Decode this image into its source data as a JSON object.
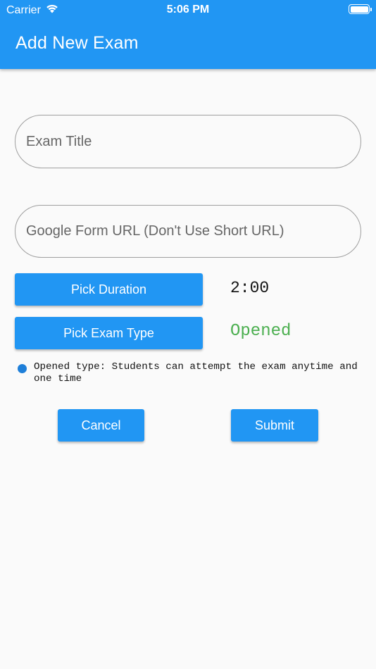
{
  "status_bar": {
    "carrier": "Carrier",
    "time": "5:06 PM",
    "icons": [
      "wifi-icon",
      "battery-icon"
    ]
  },
  "app_bar": {
    "title": "Add New Exam",
    "color": "#2196f3"
  },
  "form": {
    "exam_title_placeholder": "Exam Title",
    "google_form_url_placeholder": "Google Form URL (Don't Use Short URL)"
  },
  "duration": {
    "button_label": "Pick Duration",
    "value": "2:00"
  },
  "exam_type": {
    "button_label": "Pick Exam Type",
    "value": "Opened",
    "value_color": "#4caf50"
  },
  "note": "Opened type: Students can attempt the exam anytime and one time",
  "actions": {
    "cancel_label": "Cancel",
    "submit_label": "Submit"
  }
}
